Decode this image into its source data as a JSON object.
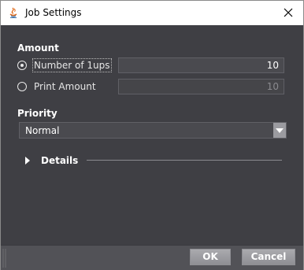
{
  "window": {
    "title": "Job Settings"
  },
  "amount": {
    "heading": "Amount",
    "options": [
      {
        "label": "Number of 1ups",
        "selected": true,
        "value": "10",
        "enabled": true
      },
      {
        "label": "Print Amount",
        "selected": false,
        "value": "10",
        "enabled": false
      }
    ]
  },
  "priority": {
    "heading": "Priority",
    "selected": "Normal"
  },
  "details": {
    "label": "Details",
    "expanded": false
  },
  "footer": {
    "ok_label": "OK",
    "cancel_label": "Cancel"
  },
  "colors": {
    "panel": "#3f3f44",
    "footer": "#525257",
    "button": "#9b9ba0"
  }
}
